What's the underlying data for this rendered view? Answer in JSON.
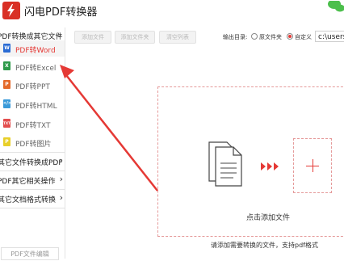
{
  "app": {
    "title": "闪电PDF转换器"
  },
  "sidebar": {
    "group1": {
      "label": "PDF转换成其它文件"
    },
    "items": [
      {
        "label": "PDF转Word",
        "icon": "word-icon",
        "badge": "W",
        "color": "#2b6cd4",
        "active": true
      },
      {
        "label": "PDF转Excel",
        "icon": "excel-icon",
        "badge": "X",
        "color": "#2e9a4a"
      },
      {
        "label": "PDF转PPT",
        "icon": "ppt-icon",
        "badge": "P",
        "color": "#e46a2b"
      },
      {
        "label": "PDF转HTML",
        "icon": "html-icon",
        "badge": "</>",
        "color": "#3a9ad9"
      },
      {
        "label": "PDF转TXT",
        "icon": "txt-icon",
        "badge": "TXT",
        "color": "#e34d4d"
      },
      {
        "label": "PDF转图片",
        "icon": "image-icon",
        "badge": "P",
        "color": "#e8cf2a"
      }
    ],
    "group2": {
      "label": "其它文件转换成PDF"
    },
    "group3": {
      "label": "PDF其它相关操作"
    },
    "group4": {
      "label": "其它文档格式转换"
    },
    "footer_button": "PDF文件编辑"
  },
  "toolbar": {
    "add_file": "添加文件",
    "add_folder": "添加文件夹",
    "clear_list": "清空列表",
    "output_label": "输出目录:",
    "option_original": "原文件夹",
    "option_custom": "自定义",
    "selected_option": "自定义",
    "path_value": "c:\\users\\"
  },
  "dropzone": {
    "label": "点击添加文件",
    "hint": "请添加需要转换的文件，支持pdf格式"
  },
  "colors": {
    "accent": "#e53935",
    "dashed_border": "#e59a9a",
    "arrow": "#e53935"
  }
}
